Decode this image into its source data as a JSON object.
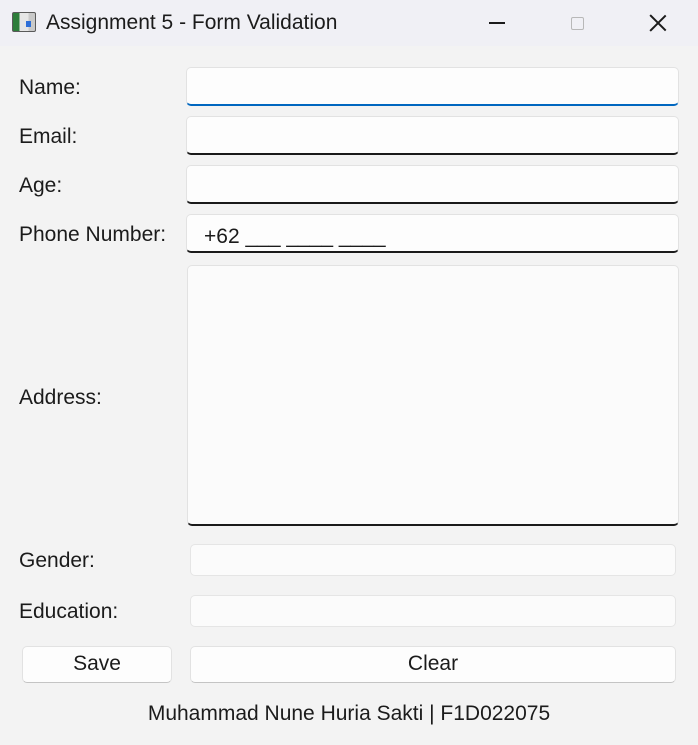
{
  "window": {
    "title": "Assignment 5 - Form Validation",
    "icon": "app-window-icon",
    "controls": {
      "minimize": "minimize-icon",
      "maximize": "maximize-icon",
      "close": "close-icon"
    }
  },
  "form": {
    "name": {
      "label": "Name:",
      "value": "",
      "focused": true
    },
    "email": {
      "label": "Email:",
      "value": ""
    },
    "age": {
      "label": "Age:",
      "value": ""
    },
    "phone": {
      "label": "Phone Number:",
      "value": "+62 ___ ____ ____"
    },
    "address": {
      "label": "Address:",
      "value": ""
    },
    "gender": {
      "label": "Gender:",
      "value": ""
    },
    "education": {
      "label": "Education:",
      "value": ""
    }
  },
  "buttons": {
    "save": "Save",
    "clear": "Clear"
  },
  "footer": {
    "text": "Muhammad Nune Huria Sakti | F1D022075"
  },
  "colors": {
    "focus_accent": "#0067c0",
    "background": "#f3f3f3",
    "titlebar": "#f0f0f5"
  }
}
